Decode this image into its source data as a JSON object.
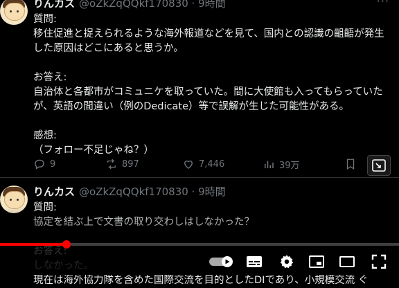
{
  "tweet1": {
    "name": "りんカス",
    "handle": "@oZkZqQQkf170830 · 9時間",
    "body": "質問:\n移住促進と捉えられるような海外報道などを見て、国内との認識の齟齬が発生した原因はどこにあると思うか。\n\nお答え:\n自治体と各都市がコミュニケを取っていた。間に大使館も入ってもらっていたが、英語の間違い（例のDedicate）等で誤解が生じた可能性がある。\n\n感想:\n（フォロー不足じゃね？）",
    "replies": "9",
    "reposts": "897",
    "likes": "7,446",
    "views": "39万"
  },
  "tweet2": {
    "name": "りんカス",
    "handle": "@oZkZqQQkf170830 · 9時間",
    "body": "質問:\n協定を結ぶ上で文書の取り交わしはしなかった？\n\nお答え:\nしなかった。\n現在は海外協力隊を含めた国際交流を目的としたDIであり、小規模交流 ぐ"
  },
  "player": {
    "progress_fraction": 0.167,
    "accent": "#ff0000",
    "controls": [
      "autoplay-toggle",
      "subtitles-icon",
      "settings-gear-icon",
      "miniplayer-icon",
      "theater-mode-icon",
      "fullscreen-icon"
    ]
  }
}
